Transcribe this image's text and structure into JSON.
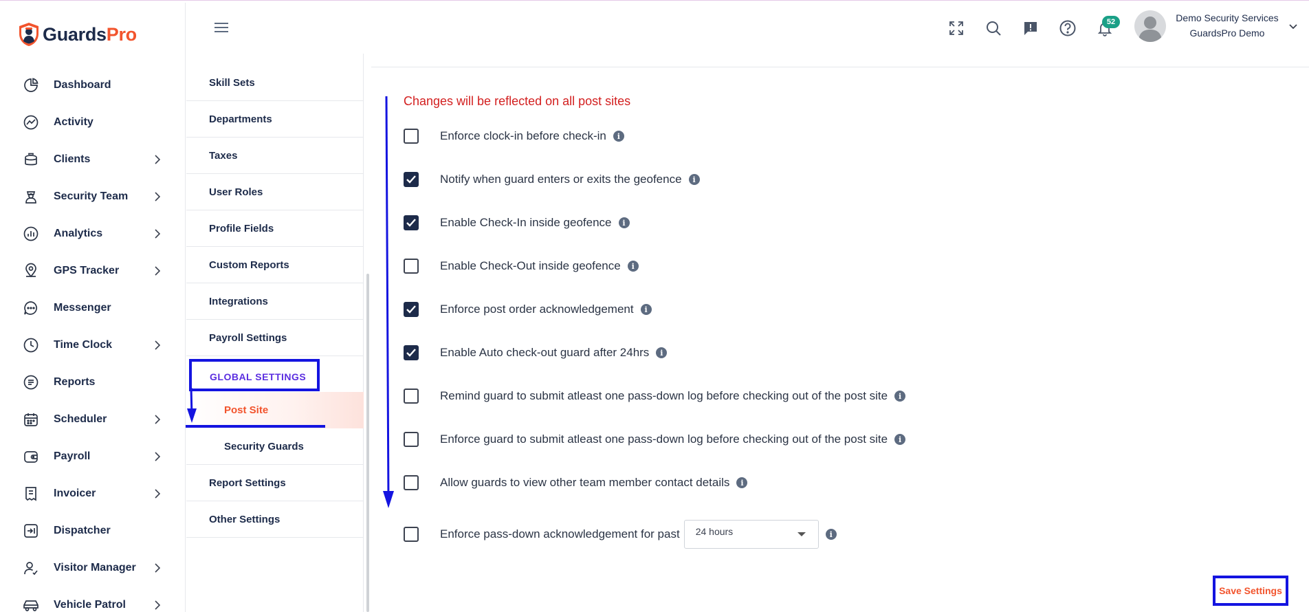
{
  "brand": {
    "name_part1": "Guards",
    "name_part2": "Pro",
    "accent": "#f2542d",
    "dark": "#1d2b4a"
  },
  "sidebar": {
    "items": [
      {
        "label": "Dashboard",
        "icon": "dashboard-icon",
        "has_submenu": false
      },
      {
        "label": "Activity",
        "icon": "activity-icon",
        "has_submenu": false
      },
      {
        "label": "Clients",
        "icon": "clients-icon",
        "has_submenu": true
      },
      {
        "label": "Security Team",
        "icon": "security-team-icon",
        "has_submenu": true
      },
      {
        "label": "Analytics",
        "icon": "analytics-icon",
        "has_submenu": true
      },
      {
        "label": "GPS Tracker",
        "icon": "location-pin-icon",
        "has_submenu": true
      },
      {
        "label": "Messenger",
        "icon": "chat-icon",
        "has_submenu": false
      },
      {
        "label": "Time Clock",
        "icon": "clock-icon",
        "has_submenu": true
      },
      {
        "label": "Reports",
        "icon": "reports-icon",
        "has_submenu": false
      },
      {
        "label": "Scheduler",
        "icon": "calendar-icon",
        "has_submenu": true
      },
      {
        "label": "Payroll",
        "icon": "wallet-icon",
        "has_submenu": true
      },
      {
        "label": "Invoicer",
        "icon": "invoice-icon",
        "has_submenu": true
      },
      {
        "label": "Dispatcher",
        "icon": "dispatch-icon",
        "has_submenu": false
      },
      {
        "label": "Visitor Manager",
        "icon": "visitor-icon",
        "has_submenu": true
      },
      {
        "label": "Vehicle Patrol",
        "icon": "car-icon",
        "has_submenu": true
      }
    ]
  },
  "header": {
    "notification_count": "52",
    "user_name": "Demo Security Services",
    "user_company": "GuardsPro Demo",
    "icons": [
      "fullscreen-icon",
      "search-icon",
      "feedback-icon",
      "help-icon",
      "bell-icon"
    ]
  },
  "settings_menu": {
    "items_top": [
      "Skill Sets",
      "Departments",
      "Taxes",
      "User Roles",
      "Profile Fields",
      "Custom Reports",
      "Integrations",
      "Payroll Settings"
    ],
    "group_label": "GLOBAL SETTINGS",
    "group_children": [
      "Post Site",
      "Security Guards"
    ],
    "active_child": "Post Site",
    "items_bottom": [
      "Report Settings",
      "Other Settings"
    ]
  },
  "main": {
    "warning": "Changes will be reflected on all post sites",
    "options": [
      {
        "label": "Enforce clock-in before check-in",
        "checked": false
      },
      {
        "label": "Notify when guard enters or exits the geofence",
        "checked": true
      },
      {
        "label": "Enable Check-In inside geofence",
        "checked": true
      },
      {
        "label": "Enable Check-Out inside geofence",
        "checked": false
      },
      {
        "label": "Enforce post order acknowledgement",
        "checked": true
      },
      {
        "label": "Enable Auto check-out guard after 24hrs",
        "checked": true
      },
      {
        "label": "Remind guard to submit atleast one pass-down log before checking out of the post site",
        "checked": false
      },
      {
        "label": "Enforce guard to submit atleast one pass-down log before checking out of the post site",
        "checked": false
      },
      {
        "label": "Allow guards to view other team member contact details",
        "checked": false
      }
    ],
    "passdown": {
      "label": "Enforce pass-down acknowledgement for past",
      "checked": false,
      "select_value": "24 hours"
    },
    "save_label": "Save Settings"
  }
}
